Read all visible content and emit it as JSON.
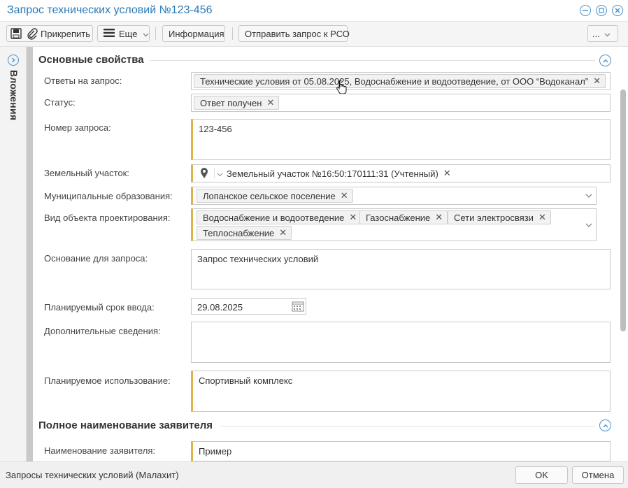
{
  "window": {
    "title": "Запрос технических условий №123-456",
    "buttons": {
      "minimize": "—",
      "maximize": "⤢",
      "close": "✕"
    }
  },
  "toolbar": {
    "attach_label": "Прикрепить",
    "more_label": "Еще",
    "info_label": "Информация",
    "send_label": "Отправить запрос к РСО",
    "overflow_label": "..."
  },
  "side": {
    "label": "Вложения"
  },
  "sections": {
    "main": "Основные свойства",
    "applicant": "Полное наименование заявителя"
  },
  "fields": {
    "answers": {
      "label": "Ответы на запрос:",
      "tag": "Технические условия от 05.08.2025, Водоснабжение и водоотведение, от ООО “Водоканал”"
    },
    "status": {
      "label": "Статус:",
      "tag": "Ответ получен"
    },
    "number": {
      "label": "Номер запроса:",
      "value": "123-456"
    },
    "land": {
      "label": "Земельный участок:",
      "tag": "Земельный участок №16:50:170111:31 (Учтенный)"
    },
    "municipal": {
      "label": "Муниципальные образования:",
      "tag": "Лопанское сельское поселение"
    },
    "object_type": {
      "label": "Вид объекта проектирования:",
      "tags": [
        "Водоснабжение и водоотведение",
        "Газоснабжение",
        "Сети электросвязи",
        "Теплоснабжение"
      ]
    },
    "basis": {
      "label": "Основание для запроса:",
      "value": "Запрос технических условий"
    },
    "planned_date": {
      "label": "Планируемый срок ввода:",
      "value": "29.08.2025"
    },
    "extra": {
      "label": "Дополнительные сведения:",
      "value": ""
    },
    "usage": {
      "label": "Планируемое использование:",
      "value": "Спортивный комплекс"
    },
    "applicant_name": {
      "label": "Наименование заявителя:",
      "value": "Пример"
    }
  },
  "footer": {
    "text": "Запросы технических условий (Малахит)",
    "ok": "OK",
    "cancel": "Отмена"
  },
  "colors": {
    "accent": "#2a7ab8",
    "required": "#e0b34a"
  },
  "icons": [
    "save-icon",
    "paperclip-icon",
    "menu-icon",
    "map-pin-icon",
    "calendar-icon",
    "chevron-down-icon",
    "close-icon",
    "collapse-icon",
    "hand-cursor-icon"
  ]
}
